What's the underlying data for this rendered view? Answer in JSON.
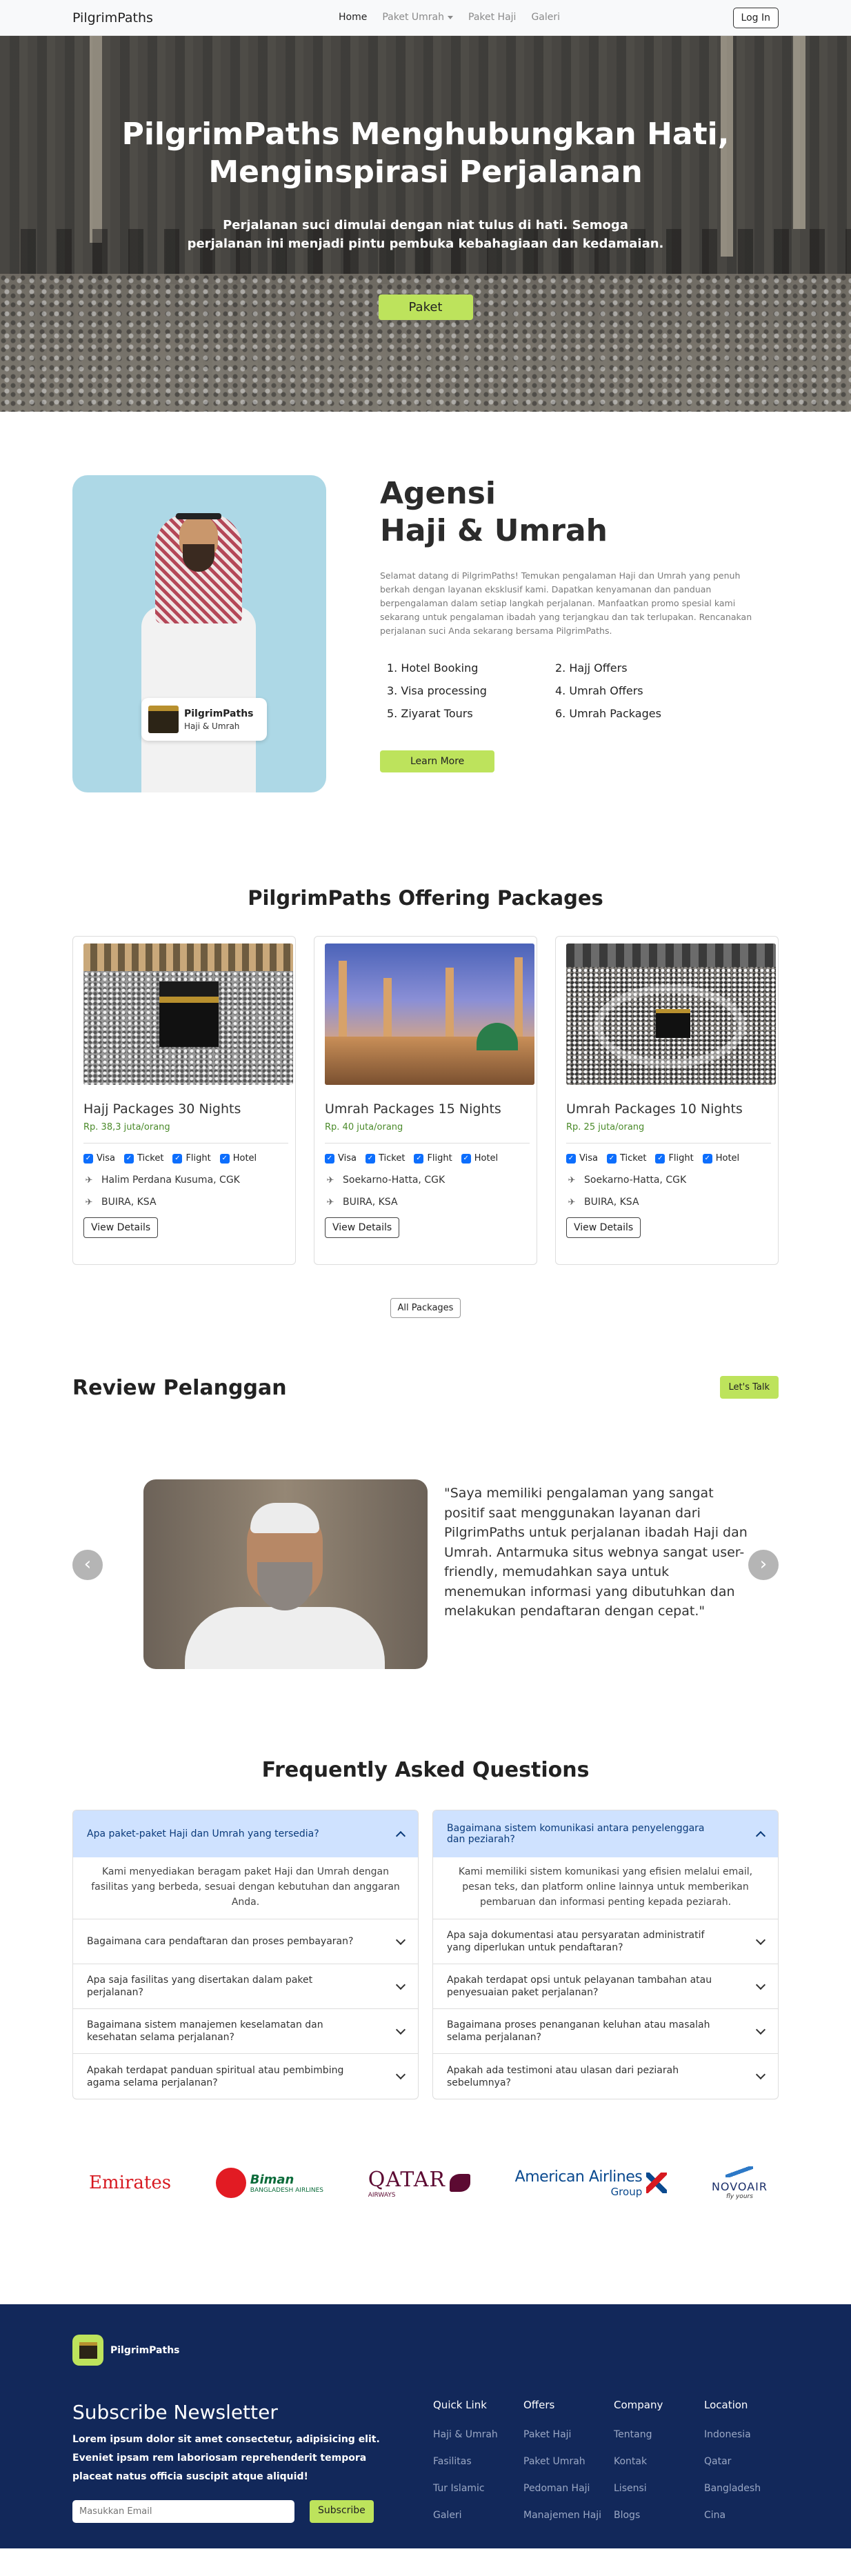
{
  "navbar": {
    "brand": "PilgrimPaths",
    "links": [
      "Home",
      "Paket Umrah",
      "Paket Haji",
      "Galeri"
    ],
    "login_label": "Log In"
  },
  "hero": {
    "title": "PilgrimPaths Menghubungkan Hati, Menginspirasi Perjalanan",
    "subtitle": "Perjalanan suci dimulai dengan niat tulus di hati. Semoga perjalanan ini menjadi pintu pembuka kebahagiaan dan kedamaian.",
    "cta_label": "Paket"
  },
  "agency": {
    "title_line1": "Agensi",
    "title_line2": "Haji & Umrah",
    "badge_title": "PilgrimPaths",
    "badge_sub": "Haji & Umrah",
    "description": "Selamat datang di PilgrimPaths! Temukan pengalaman Haji dan Umrah yang penuh berkah dengan layanan eksklusif kami. Dapatkan kenyamanan dan panduan berpengalaman dalam setiap langkah perjalanan. Manfaatkan promo spesial kami sekarang untuk pengalaman ibadah yang terjangkau dan tak terlupakan. Rencanakan perjalanan suci Anda sekarang bersama PilgrimPaths.",
    "services": [
      "1. Hotel Booking",
      "2. Hajj Offers",
      "3. Visa processing",
      "4. Umrah Offers",
      "5. Ziyarat Tours",
      "6. Umrah Packages"
    ],
    "learn_label": "Learn More"
  },
  "packages": {
    "title": "PilgrimPaths Offering Packages",
    "cards": [
      {
        "title": "Hajj Packages 30 Nights",
        "price": "Rp. 38,3 juta/orang",
        "departure": "Halim Perdana Kusuma, CGK",
        "arrival": "BUIRA, KSA",
        "button": "View Details"
      },
      {
        "title": "Umrah Packages 15 Nights",
        "price": "Rp. 40 juta/orang",
        "departure": "Soekarno-Hatta, CGK",
        "arrival": "BUIRA, KSA",
        "button": "View Details"
      },
      {
        "title": "Umrah Packages 10 Nights",
        "price": "Rp. 25 juta/orang",
        "departure": "Soekarno-Hatta, CGK",
        "arrival": "BUIRA, KSA",
        "button": "View Details"
      }
    ],
    "features": [
      "Visa",
      "Ticket",
      "Flight",
      "Hotel"
    ],
    "all_label": "All Packages"
  },
  "review": {
    "title": "Review Pelanggan",
    "talk_label": "Let's Talk",
    "quote": "\"Saya memiliki pengalaman yang sangat positif saat menggunakan layanan dari PilgrimPaths untuk perjalanan ibadah Haji dan Umrah. Antarmuka situs webnya sangat user-friendly, memudahkan saya untuk menemukan informasi yang dibutuhkan dan melakukan pendaftaran dengan cepat.\""
  },
  "faq": {
    "title": "Frequently Asked Questions",
    "left": {
      "open_question": "Apa paket-paket Haji dan Umrah yang tersedia?",
      "open_answer": "Kami menyediakan beragam paket Haji dan Umrah dengan fasilitas yang berbeda, sesuai dengan kebutuhan dan anggaran Anda.",
      "items": [
        "Bagaimana cara pendaftaran dan proses pembayaran?",
        "Apa saja fasilitas yang disertakan dalam paket perjalanan?",
        "Bagaimana sistem manajemen keselamatan dan kesehatan selama perjalanan?",
        "Apakah terdapat panduan spiritual atau pembimbing agama selama perjalanan?"
      ]
    },
    "right": {
      "open_question": "Bagaimana sistem komunikasi antara penyelenggara dan peziarah?",
      "open_answer": "Kami memiliki sistem komunikasi yang efisien melalui email, pesan teks, dan platform online lainnya untuk memberikan pembaruan dan informasi penting kepada peziarah.",
      "items": [
        "Apa saja dokumentasi atau persyaratan administratif yang diperlukan untuk pendaftaran?",
        "Apakah terdapat opsi untuk pelayanan tambahan atau penyesuaian paket perjalanan?",
        "Bagaimana proses penanganan keluhan atau masalah selama perjalanan?",
        "Apakah ada testimoni atau ulasan dari peziarah sebelumnya?"
      ]
    }
  },
  "airlines": {
    "emirates": "Emirates",
    "biman": "Biman",
    "biman_sub": "BANGLADESH AIRLINES",
    "qatar": "QATAR",
    "qatar_sub": "AIRWAYS",
    "american": "American Airlines",
    "american_sub": "Group",
    "novo": "NOVOAIR",
    "novo_sub": "fly yours"
  },
  "footer": {
    "brand": "PilgrimPaths",
    "newsletter_title": "Subscribe Newsletter",
    "newsletter_text": "Lorem ipsum dolor sit amet consectetur, adipisicing elit. Eveniet ipsam rem laboriosam reprehenderit tempora placeat natus officia suscipit atque aliquid!",
    "email_placeholder": "Masukkan Email",
    "subscribe_label": "Subscribe",
    "columns": [
      {
        "title": "Quick Link",
        "items": [
          "Haji & Umrah",
          "Fasilitas",
          "Tur Islamic",
          "Galeri"
        ]
      },
      {
        "title": "Offers",
        "items": [
          "Paket Haji",
          "Paket Umrah",
          "Pedoman Haji",
          "Manajemen Haji"
        ]
      },
      {
        "title": "Company",
        "items": [
          "Tentang",
          "Kontak",
          "Lisensi",
          "Blogs"
        ]
      },
      {
        "title": "Location",
        "items": [
          "Indonesia",
          "Qatar",
          "Bangladesh",
          "Cina"
        ]
      }
    ]
  }
}
